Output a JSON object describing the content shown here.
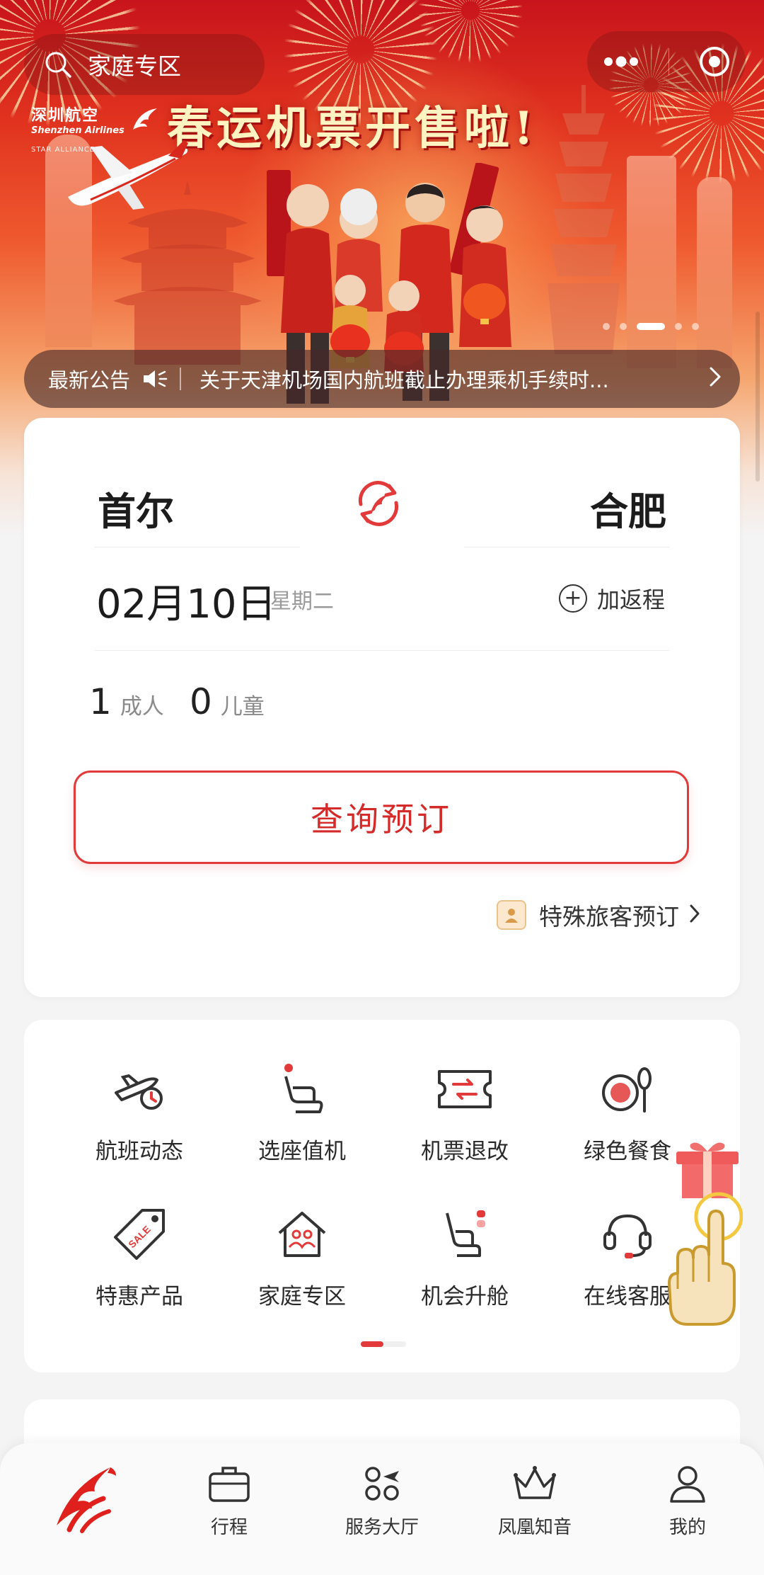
{
  "top": {
    "search_placeholder": "家庭专区"
  },
  "banner": {
    "airline_cn": "深圳航空",
    "airline_en": "Shenzhen Airlines",
    "alliance": "STAR ALLIANCE",
    "headline": "春运机票开售啦!",
    "carousel_count": 5,
    "carousel_active": 3
  },
  "notice": {
    "label": "最新公告",
    "text": "关于天津机场国内航班截止办理乘机手续时..."
  },
  "booking": {
    "from_city": "首尔",
    "to_city": "合肥",
    "date": "02月10日",
    "weekday": "星期二",
    "add_return": "加返程",
    "adults": "1",
    "adult_unit": "成人",
    "children": "0",
    "child_unit": "儿童",
    "search_button": "查询预订",
    "special_booking": "特殊旅客预订"
  },
  "services": [
    {
      "label": "航班动态",
      "icon": "flight-status-icon"
    },
    {
      "label": "选座值机",
      "icon": "seat-checkin-icon"
    },
    {
      "label": "机票退改",
      "icon": "ticket-change-icon"
    },
    {
      "label": "绿色餐食",
      "icon": "meal-icon"
    },
    {
      "label": "特惠产品",
      "icon": "sale-tag-icon"
    },
    {
      "label": "家庭专区",
      "icon": "family-home-icon"
    },
    {
      "label": "机会升舱",
      "icon": "upgrade-seat-icon"
    },
    {
      "label": "在线客服",
      "icon": "headset-icon"
    }
  ],
  "tabbar": [
    {
      "label": "",
      "icon": "shenzhen-airlines-logo"
    },
    {
      "label": "行程",
      "icon": "suitcase-icon"
    },
    {
      "label": "服务大厅",
      "icon": "service-hall-icon"
    },
    {
      "label": "凤凰知音",
      "icon": "crown-icon"
    },
    {
      "label": "我的",
      "icon": "user-icon"
    }
  ],
  "colors": {
    "accent": "#e23a3a",
    "banner_red": "#d8271d",
    "text": "#1c1c1c"
  }
}
